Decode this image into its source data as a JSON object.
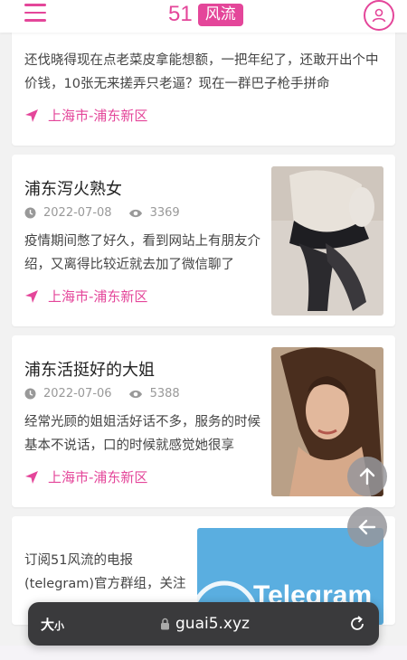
{
  "header": {
    "logo_number": "51",
    "logo_badge": "风流"
  },
  "posts": [
    {
      "excerpt": "还伐晓得现在点老菜皮拿能想额，一把年纪了，还敢开出个中价钱，10张无来搓弄只老逼？现在一群巴子枪手拼命",
      "location": "上海市-浦东新区"
    },
    {
      "title": "浦东泻火熟女",
      "date": "2022-07-08",
      "views": "3369",
      "excerpt": "疫情期间憋了好久，看到网站上有朋友介绍，又离得比较近就去加了微信聊了",
      "location": "上海市-浦东新区"
    },
    {
      "title": "浦东活挺好的大姐",
      "date": "2022-07-06",
      "views": "5388",
      "excerpt": "经常光顾的姐姐活好话不多，服务的时候基本不说话，口的时候就感觉她很享",
      "location": "上海市-浦东新区"
    },
    {
      "excerpt": "订阅51风流的电报(telegram)官方群组，关注",
      "banner_text": "Telegram"
    }
  ],
  "browser": {
    "font_size_label": "大",
    "font_size_small": "小",
    "url": "guai5.xyz"
  },
  "colors": {
    "accent": "#e4469a",
    "telegram_blue": "#5aaee0"
  }
}
